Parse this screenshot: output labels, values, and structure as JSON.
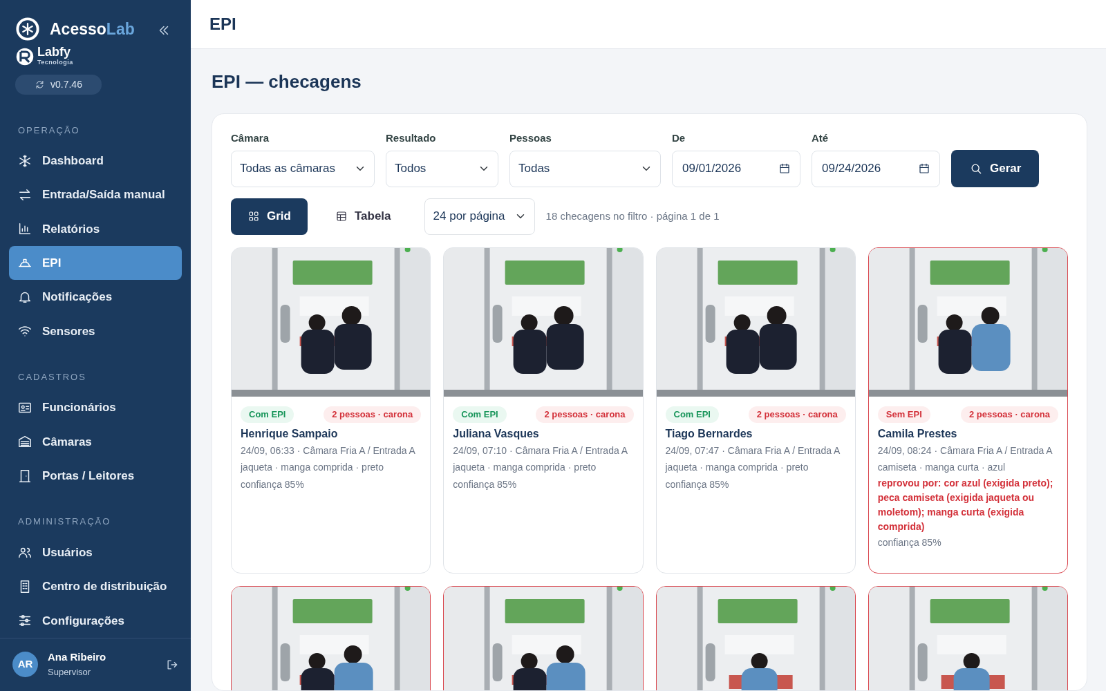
{
  "sidebar": {
    "brand": {
      "main": "Acesso",
      "accent": "Lab"
    },
    "partner": {
      "name": "Labfy",
      "tagline": "Tecnologia"
    },
    "version": "v0.7.46",
    "sections": [
      {
        "title": "OPERAÇÃO",
        "items": [
          {
            "label": "Dashboard",
            "selected": false
          },
          {
            "label": "Entrada/Saída manual",
            "selected": false
          },
          {
            "label": "Relatórios",
            "selected": false
          },
          {
            "label": "EPI",
            "selected": true
          },
          {
            "label": "Notificações",
            "selected": false
          },
          {
            "label": "Sensores",
            "selected": false
          }
        ]
      },
      {
        "title": "CADASTROS",
        "items": [
          {
            "label": "Funcionários",
            "selected": false
          },
          {
            "label": "Câmaras",
            "selected": false
          },
          {
            "label": "Portas / Leitores",
            "selected": false
          }
        ]
      },
      {
        "title": "ADMINISTRAÇÃO",
        "items": [
          {
            "label": "Usuários",
            "selected": false
          },
          {
            "label": "Centro de distribuição",
            "selected": false
          },
          {
            "label": "Configurações",
            "selected": false
          }
        ]
      }
    ],
    "user": {
      "initials": "AR",
      "name": "Ana Ribeiro",
      "role": "Supervisor"
    }
  },
  "header": {
    "title": "EPI"
  },
  "page_title": "EPI — checagens",
  "filters": [
    {
      "kind": "select",
      "label": "Câmara",
      "value": "Todas as câmaras"
    },
    {
      "kind": "select",
      "label": "Resultado",
      "value": "Todos"
    },
    {
      "kind": "select",
      "label": "Pessoas",
      "value": "Todas"
    },
    {
      "kind": "date",
      "label": "De",
      "value": "09/01/2026"
    },
    {
      "kind": "date",
      "label": "Até",
      "value": "09/24/2026"
    }
  ],
  "generate_button": "Gerar",
  "views": [
    {
      "label": "Grid",
      "selected": true
    },
    {
      "label": "Tabela",
      "selected": false
    }
  ],
  "page_size": "24 por página",
  "summary": "18 checagens no filtro · página 1 de 1",
  "cards": [
    {
      "ok": true,
      "result": "Com EPI",
      "people": "2 pessoas · carona",
      "name": "Henrique Sampaio",
      "meta": "24/09, 06:33 · Câmara Fria A / Entrada A",
      "clothing": "jaqueta · manga comprida · preto",
      "confidence": "confiança 85%"
    },
    {
      "ok": true,
      "result": "Com EPI",
      "people": "2 pessoas · carona",
      "name": "Juliana Vasques",
      "meta": "24/09, 07:10 · Câmara Fria A / Entrada A",
      "clothing": "jaqueta · manga comprida · preto",
      "confidence": "confiança 85%"
    },
    {
      "ok": true,
      "result": "Com EPI",
      "people": "2 pessoas · carona",
      "name": "Tiago Bernardes",
      "meta": "24/09, 07:47 · Câmara Fria A / Entrada A",
      "clothing": "jaqueta · manga comprida · preto",
      "confidence": "confiança 85%"
    },
    {
      "ok": false,
      "result": "Sem EPI",
      "people": "2 pessoas · carona",
      "name": "Camila Prestes",
      "meta": "24/09, 08:24 · Câmara Fria A / Entrada A",
      "clothing": "camiseta · manga curta · azul",
      "reason": "reprovou por: cor azul (exigida preto); peca camiseta (exigida jaqueta ou moletom); manga curta (exigida comprida)",
      "confidence": "confiança 85%"
    },
    {
      "ok": false
    },
    {
      "ok": false
    },
    {
      "ok": false
    },
    {
      "ok": false
    }
  ]
}
